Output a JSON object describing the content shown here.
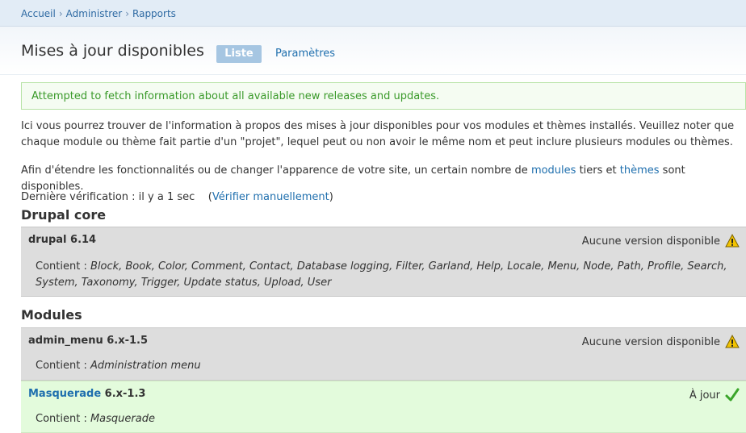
{
  "breadcrumb": {
    "items": [
      "Accueil",
      "Administrer",
      "Rapports"
    ],
    "sep": "›"
  },
  "header": {
    "title": "Mises à jour disponibles",
    "tabs": [
      {
        "label": "Liste",
        "active": true
      },
      {
        "label": "Paramètres",
        "active": false
      }
    ]
  },
  "message": "Attempted to fetch information about all available new releases and updates.",
  "intro": {
    "p1": "Ici vous pourrez trouver de l'information à propos des mises à jour disponibles pour vos modules et thèmes installés. Veuillez noter que chaque module ou thème fait partie d'un \"projet\", lequel peut ou non avoir le même nom et peut inclure plusieurs modules ou thèmes.",
    "p2_before": "Afin d'étendre les fonctionnalités ou de changer l'apparence de votre site, un certain nombre de ",
    "p2_link1": "modules",
    "p2_mid": " tiers et ",
    "p2_link2": "thèmes",
    "p2_after": " sont disponibles."
  },
  "lastcheck": {
    "label": "Dernière vérification : il y a 1 sec",
    "open": "(",
    "link": "Vérifier manuellement",
    "close": ")"
  },
  "sections": {
    "core": {
      "title": "Drupal core",
      "project": {
        "name": "drupal 6.14",
        "status": "Aucune version disponible",
        "status_icon": "warning-icon",
        "contains_label": "Contient :",
        "contains": "Block, Book, Color, Comment, Contact, Database logging, Filter, Garland, Help, Locale, Menu, Node, Path, Profile, Search, System, Taxonomy, Trigger, Update status, Upload, User"
      }
    },
    "modules": {
      "title": "Modules",
      "projects": [
        {
          "name": "admin_menu 6.x-1.5",
          "status": "Aucune version disponible",
          "status_icon": "warning-icon",
          "contains_label": "Contient :",
          "contains": "Administration menu"
        },
        {
          "name_link": "Masquerade",
          "version": "6.x-1.3",
          "status": "À jour",
          "status_icon": "check-icon",
          "contains_label": "Contient :",
          "contains": "Masquerade"
        }
      ]
    }
  },
  "colors": {
    "link": "#1f6fae",
    "ok_bg": "#e3fbdc",
    "warn_bg": "#dddddd",
    "message_green": "#3a9a2a",
    "tab_active": "#a6c6e2"
  }
}
